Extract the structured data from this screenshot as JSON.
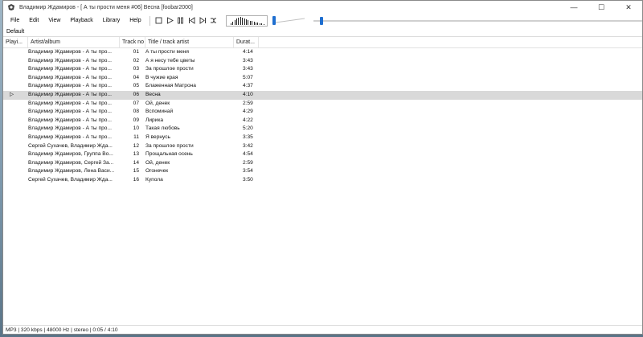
{
  "window": {
    "title": "Владимир Ждамиров - [ А ты прости меня #06] Весна  [foobar2000]",
    "minimize_glyph": "—",
    "maximize_glyph": "☐",
    "close_glyph": "✕"
  },
  "menu": [
    "File",
    "Edit",
    "View",
    "Playback",
    "Library",
    "Help"
  ],
  "toolbar": {
    "buttons": [
      "stop-icon",
      "play-icon",
      "pause-icon",
      "previous-icon",
      "next-icon",
      "random-icon"
    ],
    "volume_level": 0.0,
    "seek_position": "0:05 / 4:10"
  },
  "playlist_tab": "Default",
  "columns": {
    "playing": "Playi...",
    "artist": "Artist/album",
    "track": "Track no",
    "title": "Title / track artist",
    "duration": "Durat..."
  },
  "tracks": [
    {
      "artist": "Владимир Ждамиров -  А ты про...",
      "track": "01",
      "title": "А ты прости меня",
      "duration": "4:14"
    },
    {
      "artist": "Владимир Ждамиров -  А ты про...",
      "track": "02",
      "title": "А я несу тебе цветы",
      "duration": "3:43"
    },
    {
      "artist": "Владимир Ждамиров -  А ты про...",
      "track": "03",
      "title": "За прошлое прости",
      "duration": "3:43"
    },
    {
      "artist": "Владимир Ждамиров -  А ты про...",
      "track": "04",
      "title": "В чужие края",
      "duration": "5:07"
    },
    {
      "artist": "Владимир Ждамиров -  А ты про...",
      "track": "05",
      "title": "Блаженная Матрона",
      "duration": "4:37"
    },
    {
      "artist": "Владимир Ждамиров -  А ты про...",
      "track": "06",
      "title": "Весна",
      "duration": "4:10",
      "playing": "▷",
      "selected": true
    },
    {
      "artist": "Владимир Ждамиров -  А ты про...",
      "track": "07",
      "title": "Ой, денек",
      "duration": "2:59"
    },
    {
      "artist": "Владимир Ждамиров -  А ты про...",
      "track": "08",
      "title": "Вспоминай",
      "duration": "4:29"
    },
    {
      "artist": "Владимир Ждамиров -  А ты про...",
      "track": "09",
      "title": "Лирика",
      "duration": "4:22"
    },
    {
      "artist": "Владимир Ждамиров -  А ты про...",
      "track": "10",
      "title": "Такая любовь",
      "duration": "5:20"
    },
    {
      "artist": "Владимир Ждамиров -  А ты про...",
      "track": "11",
      "title": "Я вернусь",
      "duration": "3:35"
    },
    {
      "artist": "Сергей Сухачев, Владимир Жда...",
      "track": "12",
      "title": "За прошлое прости",
      "duration": "3:42"
    },
    {
      "artist": "Владимир Ждамиров, Группа Во...",
      "track": "13",
      "title": "Прощальная осень",
      "duration": "4:54"
    },
    {
      "artist": "Владимир Ждамиров, Сергей За...",
      "track": "14",
      "title": "Ой, денек",
      "duration": "2:59"
    },
    {
      "artist": "Владимир Ждамиров, Лена Васи...",
      "track": "15",
      "title": "Огонечек",
      "duration": "3:54"
    },
    {
      "artist": "Сергей Сухачев, Владимир Жда...",
      "track": "16",
      "title": "Купола",
      "duration": "3:50"
    }
  ],
  "status": "MP3 | 320 kbps | 48000 Hz | stereo | 0:05 / 4:10",
  "colors": {
    "accent": "#1f6fd0",
    "selected_row": "#d9d9d9"
  }
}
